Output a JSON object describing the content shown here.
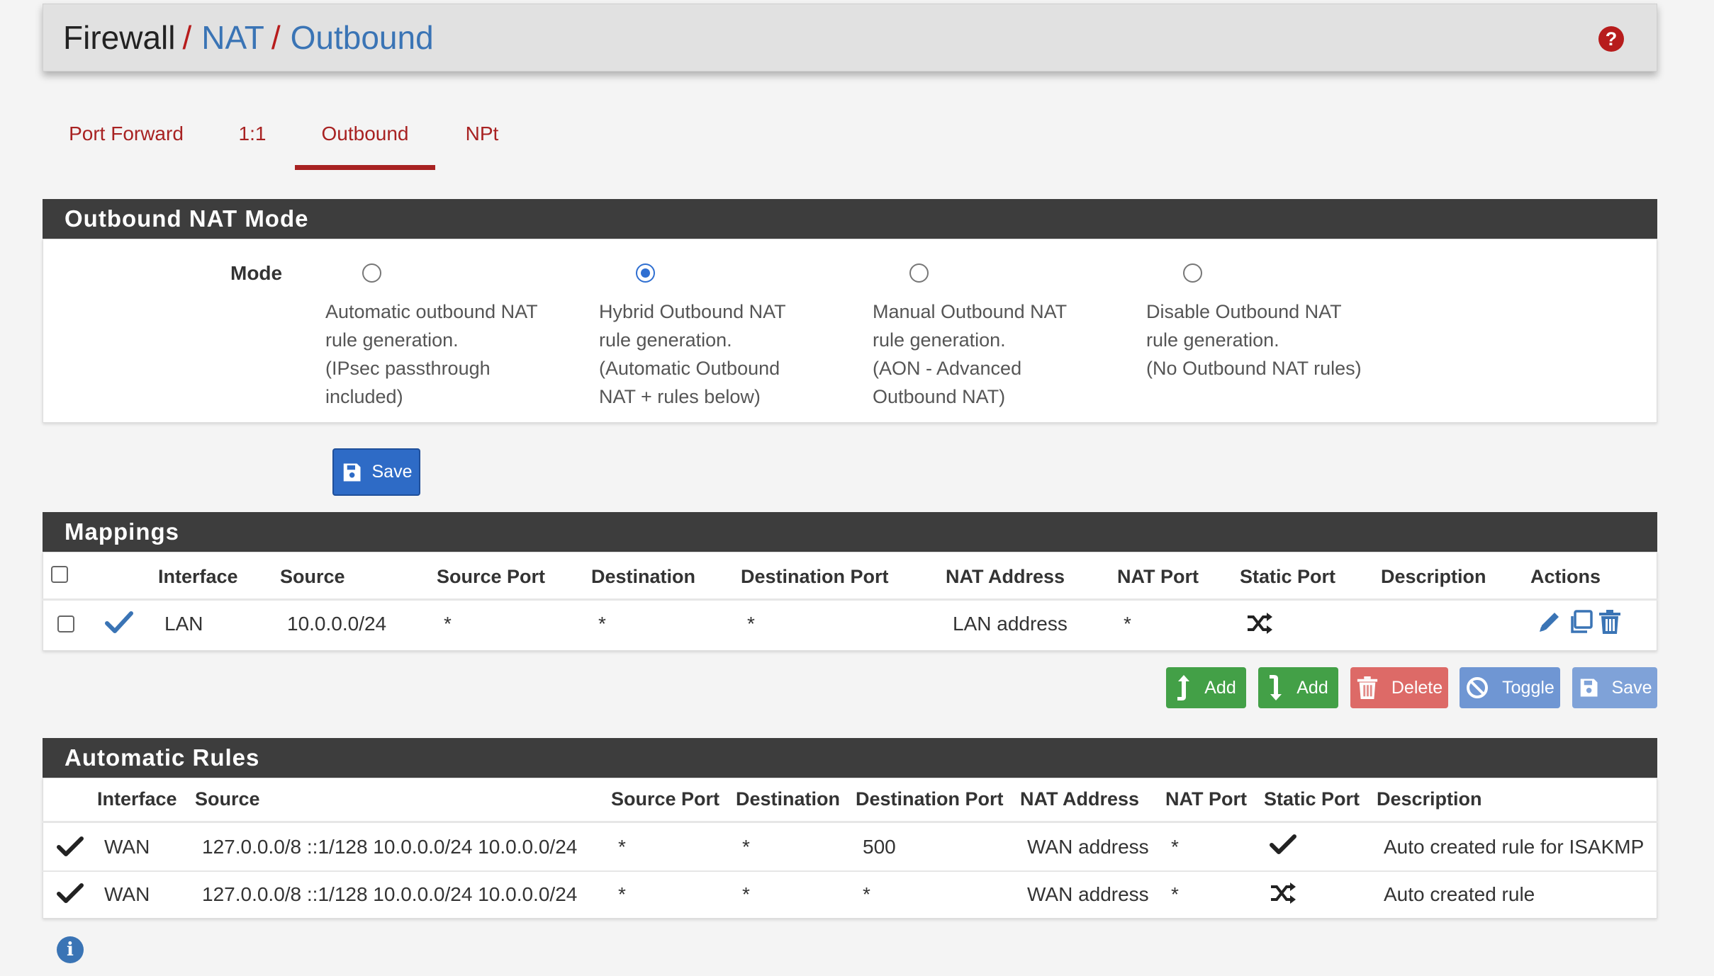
{
  "breadcrumb": {
    "part1": "Firewall",
    "part2": "NAT",
    "part3": "Outbound",
    "separator": "/"
  },
  "help_icon_glyph": "?",
  "tabs": [
    {
      "label": "Port Forward",
      "active": false
    },
    {
      "label": "1:1",
      "active": false
    },
    {
      "label": "Outbound",
      "active": true
    },
    {
      "label": "NPt",
      "active": false
    }
  ],
  "nat_mode": {
    "title": "Outbound NAT Mode",
    "mode_label": "Mode",
    "selected": "hybrid",
    "options": [
      {
        "id": "automatic",
        "lines": [
          "Automatic outbound NAT",
          "rule generation.",
          "(IPsec passthrough",
          "included)"
        ]
      },
      {
        "id": "hybrid",
        "lines": [
          "Hybrid Outbound NAT",
          "rule generation.",
          "(Automatic Outbound",
          "NAT + rules below)"
        ]
      },
      {
        "id": "manual",
        "lines": [
          "Manual Outbound NAT",
          "rule generation.",
          "(AON - Advanced",
          "Outbound NAT)"
        ]
      },
      {
        "id": "disable",
        "lines": [
          "Disable Outbound NAT",
          "rule generation.",
          "(No Outbound NAT rules)"
        ]
      }
    ],
    "save_label": "Save"
  },
  "mappings": {
    "title": "Mappings",
    "columns": [
      "Interface",
      "Source",
      "Source Port",
      "Destination",
      "Destination Port",
      "NAT Address",
      "NAT Port",
      "Static Port",
      "Description",
      "Actions"
    ],
    "rows": [
      {
        "interface": "LAN",
        "source": "10.0.0.0/24",
        "source_port": "*",
        "destination": "*",
        "destination_port": "*",
        "nat_address": "LAN address",
        "nat_port": "*",
        "static_port_icon": "shuffle-icon",
        "description": ""
      }
    ],
    "buttons": {
      "add_top": "Add",
      "add_bottom": "Add",
      "delete": "Delete",
      "toggle": "Toggle",
      "save": "Save"
    }
  },
  "automatic_rules": {
    "title": "Automatic Rules",
    "columns": [
      "Interface",
      "Source",
      "Source Port",
      "Destination",
      "Destination Port",
      "NAT Address",
      "NAT Port",
      "Static Port",
      "Description"
    ],
    "rows": [
      {
        "interface": "WAN",
        "source": "127.0.0.0/8 ::1/128 10.0.0.0/24 10.0.0.0/24",
        "source_port": "*",
        "destination": "*",
        "destination_port": "500",
        "nat_address": "WAN address",
        "nat_port": "*",
        "static_port_icon": "checkmark-icon",
        "description": "Auto created rule for ISAKMP"
      },
      {
        "interface": "WAN",
        "source": "127.0.0.0/8 ::1/128 10.0.0.0/24 10.0.0.0/24",
        "source_port": "*",
        "destination": "*",
        "destination_port": "*",
        "nat_address": "WAN address",
        "nat_port": "*",
        "static_port_icon": "shuffle-icon",
        "description": "Auto created rule"
      }
    ]
  },
  "info_icon_glyph": "i",
  "colors": {
    "accent_red": "#a82222",
    "link_blue": "#3a74b5",
    "panel_dark": "#3d3d3d",
    "primary_blue": "#2e6bc6",
    "success_green": "#43a047",
    "danger_red": "#d9534f"
  }
}
